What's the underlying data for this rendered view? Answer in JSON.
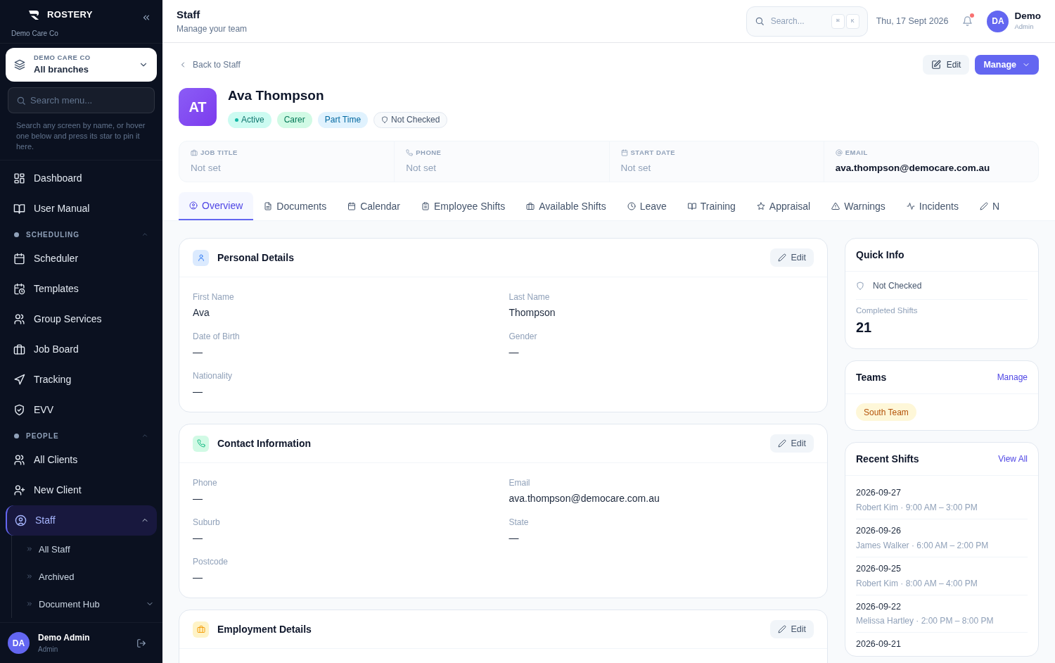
{
  "sidebar": {
    "brand": "ROSTERY",
    "org": "Demo Care Co",
    "branch_picker": {
      "label": "DEMO CARE CO",
      "value": "All branches"
    },
    "search": {
      "placeholder": "Search menu..."
    },
    "hint": "Search any screen by name, or hover one below and press its star to pin it here.",
    "items": [
      {
        "kind": "link",
        "label": "Dashboard",
        "selected": false
      },
      {
        "kind": "link",
        "label": "User Manual",
        "selected": false
      },
      {
        "kind": "section",
        "label": "SCHEDULING",
        "expanded": true
      },
      {
        "kind": "link",
        "label": "Scheduler",
        "selected": false
      },
      {
        "kind": "link",
        "label": "Templates",
        "selected": false
      },
      {
        "kind": "link",
        "label": "Group Services",
        "selected": false
      },
      {
        "kind": "link",
        "label": "Job Board",
        "selected": false
      },
      {
        "kind": "link",
        "label": "Tracking",
        "selected": false
      },
      {
        "kind": "link",
        "label": "EVV",
        "selected": false
      },
      {
        "kind": "section",
        "label": "PEOPLE",
        "expanded": true
      },
      {
        "kind": "link",
        "label": "All Clients",
        "selected": false
      },
      {
        "kind": "link",
        "label": "New Client",
        "selected": false
      },
      {
        "kind": "link",
        "label": "Staff",
        "selected": true,
        "expanded": true,
        "children": [
          {
            "label": "All Staff"
          },
          {
            "label": "Archived"
          },
          {
            "label": "Document Hub",
            "expanded": false
          }
        ]
      }
    ],
    "user": {
      "initials": "DA",
      "name": "Demo Admin",
      "role": "Admin"
    }
  },
  "header": {
    "title": "Staff",
    "subtitle": "Manage your team",
    "search": {
      "placeholder": "Search..."
    },
    "shortcut": [
      "⌘",
      "K"
    ],
    "date": "Thu, 17 Sept 2026",
    "unread": true,
    "user": {
      "initials": "DA",
      "name": "Demo",
      "role": "Admin"
    }
  },
  "profile": {
    "back": "Back to Staff",
    "edit": "Edit",
    "manage": "Manage",
    "initials": "AT",
    "name": "Ava Thompson",
    "badges": [
      {
        "kind": "status",
        "label": "Active"
      },
      {
        "kind": "role",
        "label": "Carer"
      },
      {
        "kind": "type",
        "label": "Part Time"
      },
      {
        "kind": "check",
        "label": "Not Checked"
      }
    ],
    "summary": [
      {
        "label": "JOB TITLE",
        "value": "Not set",
        "set": false
      },
      {
        "label": "PHONE",
        "value": "Not set",
        "set": false
      },
      {
        "label": "START DATE",
        "value": "Not set",
        "set": false
      },
      {
        "label": "EMAIL",
        "value": "ava.thompson@democare.com.au",
        "set": true
      }
    ]
  },
  "tabs": [
    {
      "label": "Overview",
      "selected": true
    },
    {
      "label": "Documents",
      "selected": false
    },
    {
      "label": "Calendar",
      "selected": false
    },
    {
      "label": "Employee Shifts",
      "selected": false
    },
    {
      "label": "Available Shifts",
      "selected": false
    },
    {
      "label": "Leave",
      "selected": false
    },
    {
      "label": "Training",
      "selected": false
    },
    {
      "label": "Appraisal",
      "selected": false
    },
    {
      "label": "Warnings",
      "selected": false
    },
    {
      "label": "Incidents",
      "selected": false
    },
    {
      "label": "N",
      "selected": false
    }
  ],
  "cards": [
    {
      "kind": "person",
      "title": "Personal Details",
      "edit": "Edit",
      "fields": [
        {
          "label": "First Name",
          "value": "Ava"
        },
        {
          "label": "Last Name",
          "value": "Thompson"
        },
        {
          "label": "Date of Birth",
          "value": "—"
        },
        {
          "label": "Gender",
          "value": "—"
        },
        {
          "label": "Nationality",
          "value": "—"
        }
      ]
    },
    {
      "kind": "contact",
      "title": "Contact Information",
      "edit": "Edit",
      "fields": [
        {
          "label": "Phone",
          "value": "—"
        },
        {
          "label": "Email",
          "value": "ava.thompson@democare.com.au"
        },
        {
          "label": "Suburb",
          "value": "—"
        },
        {
          "label": "State",
          "value": "—"
        },
        {
          "label": "Postcode",
          "value": "—"
        }
      ]
    },
    {
      "kind": "employment",
      "title": "Employment Details",
      "edit": "Edit"
    }
  ],
  "quick_info": {
    "title": "Quick Info",
    "check": "Not Checked",
    "stat_label": "Completed Shifts",
    "stat_value": "21"
  },
  "teams": {
    "title": "Teams",
    "action": "Manage",
    "items": [
      "South Team"
    ]
  },
  "recent_shifts": {
    "title": "Recent Shifts",
    "action": "View All",
    "items": [
      {
        "date": "2026-09-27",
        "detail": "Robert Kim · 9:00 AM – 3:00 PM"
      },
      {
        "date": "2026-09-26",
        "detail": "James Walker · 6:00 AM – 2:00 PM"
      },
      {
        "date": "2026-09-25",
        "detail": "Robert Kim · 8:00 AM – 4:00 PM"
      },
      {
        "date": "2026-09-22",
        "detail": "Melissa Hartley · 2:00 PM – 8:00 PM"
      },
      {
        "date": "2026-09-21"
      }
    ]
  }
}
